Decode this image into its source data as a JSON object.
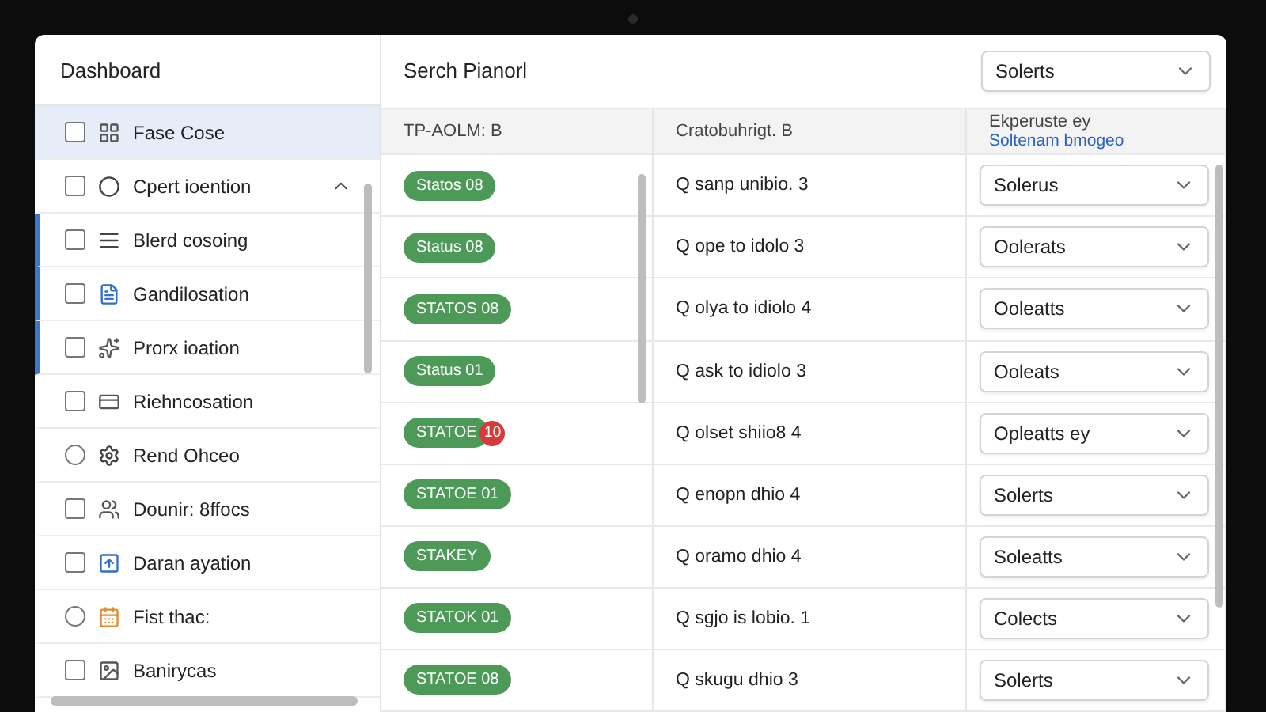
{
  "sidebar": {
    "title": "Dashboard",
    "items": [
      {
        "label": "Fase Cose",
        "kind": "checkbox",
        "checked": false,
        "selected": true
      },
      {
        "label": "Cpert ioention",
        "kind": "checkbox",
        "checked": false,
        "selected": false,
        "expanded": true,
        "children": [
          {
            "label": "Blerd cosoing",
            "kind": "checkbox",
            "checked": false,
            "selected": false
          },
          {
            "label": "Gandilosation",
            "kind": "checkbox",
            "checked": false,
            "selected": false
          },
          {
            "label": "Prorx ioation",
            "kind": "checkbox",
            "checked": false,
            "selected": false
          }
        ]
      },
      {
        "label": "Riehncosation",
        "kind": "checkbox",
        "checked": false,
        "selected": false
      },
      {
        "label": "Rend Ohceo",
        "kind": "radio",
        "checked": false,
        "selected": false
      },
      {
        "label": "Dounir: 8ffocs",
        "kind": "checkbox",
        "checked": false,
        "selected": false
      },
      {
        "label": "Daran ayation",
        "kind": "checkbox",
        "checked": false,
        "selected": false
      },
      {
        "label": "Fist thac:",
        "kind": "radio",
        "checked": false,
        "selected": false
      },
      {
        "label": "Banirycas",
        "kind": "checkbox",
        "checked": false,
        "selected": false
      }
    ]
  },
  "main": {
    "title": "Serch Pianorl",
    "filter": "Solerts"
  },
  "table": {
    "columns": [
      {
        "label": "TP-AOLM: B"
      },
      {
        "label": "Cratobuhrigt. B"
      },
      {
        "label": "Ekperuste ey",
        "link": "Soltenam bmogeo"
      }
    ],
    "rows": [
      {
        "status": "Statos 08",
        "text": "Q sanp unibio. 3",
        "choice": "Solerus"
      },
      {
        "status": "Status 08",
        "text": "Q ope to idolo 3",
        "choice": "Oolerats"
      },
      {
        "status": "STATOS 08",
        "text": "Q olya to idiolo 4",
        "choice": "Ooleatts"
      },
      {
        "status": "Status 01",
        "text": "Q ask to idiolo 3",
        "choice": "Ooleats"
      },
      {
        "status": "STATOE",
        "count": "10",
        "text": "Q olset shiio8 4",
        "choice": "Opleatts ey"
      },
      {
        "status": "STATOE 01",
        "text": "Q enopn dhio 4",
        "choice": "Solerts"
      },
      {
        "status": "STAKEY",
        "text": "Q oramo dhio 4",
        "choice": "Soleatts"
      },
      {
        "status": "STATOK 01",
        "text": "Q sgjo is lobio. 1",
        "choice": "Colects"
      },
      {
        "status": "STATOE 08",
        "text": "Q skugu dhio 3",
        "choice": "Solerts"
      }
    ]
  }
}
